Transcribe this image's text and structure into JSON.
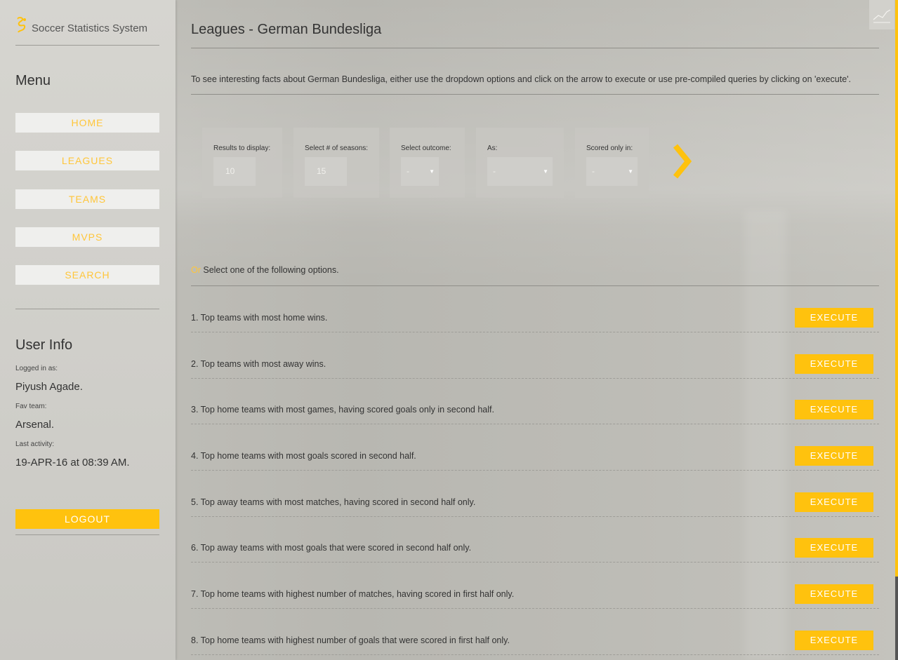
{
  "brand": {
    "name": "Soccer Statistics System"
  },
  "sidebar": {
    "menu_title": "Menu",
    "items": [
      {
        "label": "HOME"
      },
      {
        "label": "LEAGUES"
      },
      {
        "label": "TEAMS"
      },
      {
        "label": "MVPS"
      },
      {
        "label": "SEARCH"
      }
    ],
    "user_info": {
      "title": "User Info",
      "logged_in_label": "Logged in as:",
      "logged_in_value": "Piyush Agade.",
      "fav_team_label": "Fav team:",
      "fav_team_value": "Arsenal.",
      "last_activity_label": "Last activity:",
      "last_activity_value": "19-APR-16 at 08:39 AM."
    },
    "logout_label": "LOGOUT"
  },
  "main": {
    "title": "Leagues - German Bundesliga",
    "intro": "To see interesting facts about German Bundesliga, either use the dropdown options and click on the arrow to execute or use pre-compiled queries by clicking on 'execute'.",
    "filters": {
      "results": {
        "label": "Results to display:",
        "value": "10"
      },
      "seasons": {
        "label": "Select # of seasons:",
        "value": "15"
      },
      "outcome": {
        "label": "Select outcome:",
        "value": "-"
      },
      "as": {
        "label": "As:",
        "value": "-"
      },
      "scored": {
        "label": "Scored only in:",
        "value": "-"
      }
    },
    "or_word": "Or",
    "or_text": " Select one of the following options.",
    "execute_label": "EXECUTE",
    "queries": [
      {
        "text": "1. Top teams with most home wins."
      },
      {
        "text": "2. Top teams with most away wins."
      },
      {
        "text": "3. Top home teams with most games, having scored goals only in second half."
      },
      {
        "text": "4. Top home teams with most goals scored in second half."
      },
      {
        "text": "5. Top away teams with most matches, having scored in second half only."
      },
      {
        "text": "6. Top away teams with most goals that were scored in second half only."
      },
      {
        "text": "7. Top home teams with highest number of matches, having scored in first half only."
      },
      {
        "text": "8. Top home teams with highest number of goals that were scored in first half only."
      }
    ]
  },
  "colors": {
    "accent": "#ffc20e",
    "nav_text": "#ffc63a"
  },
  "icons": {
    "brand": "soccer-logo-icon",
    "arrow": "chevron-right-icon",
    "chart": "line-chart-icon",
    "caret": "caret-down-icon"
  }
}
